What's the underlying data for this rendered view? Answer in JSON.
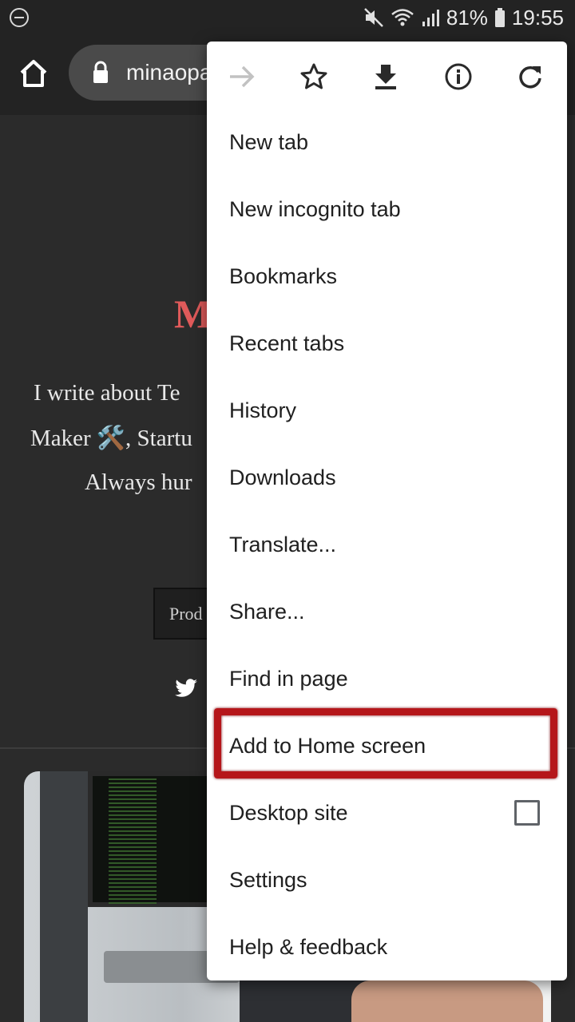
{
  "status_bar": {
    "battery_percent": "81%",
    "time": "19:55",
    "icons": [
      "dnd-icon",
      "mute-icon",
      "wifi-icon",
      "signal-icon",
      "battery-icon"
    ]
  },
  "toolbar": {
    "url": "minaopa",
    "icons": [
      "home-icon",
      "lock-icon"
    ]
  },
  "page": {
    "title_fragment": "M",
    "line1": "I write about Te",
    "line2": "Maker 🛠️, Startu",
    "line3": "Always hur",
    "button_fragment": "Prod"
  },
  "menu": {
    "top_icons": [
      "forward-icon",
      "bookmark-star-icon",
      "download-icon",
      "info-icon",
      "reload-icon"
    ],
    "items": [
      {
        "label": "New tab"
      },
      {
        "label": "New incognito tab"
      },
      {
        "label": "Bookmarks"
      },
      {
        "label": "Recent tabs"
      },
      {
        "label": "History"
      },
      {
        "label": "Downloads"
      },
      {
        "label": "Translate..."
      },
      {
        "label": "Share..."
      },
      {
        "label": "Find in page"
      },
      {
        "label": "Add to Home screen"
      },
      {
        "label": "Desktop site",
        "checked": false
      },
      {
        "label": "Settings"
      },
      {
        "label": "Help & feedback"
      }
    ]
  },
  "colors": {
    "highlight": "#b5161a",
    "site_title": "#e05a5a",
    "menu_bg": "#ffffff"
  }
}
